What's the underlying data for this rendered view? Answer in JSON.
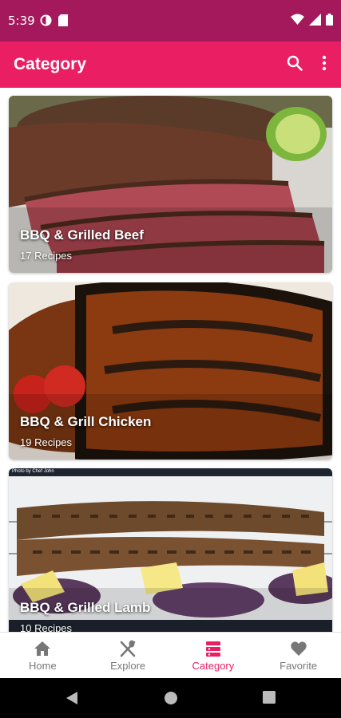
{
  "status_bar": {
    "time": "5:39"
  },
  "app_bar": {
    "title": "Category",
    "icons": [
      "search-icon",
      "more-vert-icon"
    ]
  },
  "categories": [
    {
      "title": "BBQ & Grilled Beef",
      "count": "17 Recipes"
    },
    {
      "title": "BBQ & Grill Chicken",
      "count": "19 Recipes"
    },
    {
      "title": "BBQ & Grilled Lamb",
      "count": "10 Recipes",
      "credit": "Photo by Chef John"
    }
  ],
  "bottom_nav": {
    "items": [
      {
        "label": "Home",
        "icon": "home-icon"
      },
      {
        "label": "Explore",
        "icon": "utensils-icon"
      },
      {
        "label": "Category",
        "icon": "category-icon",
        "active": true
      },
      {
        "label": "Favorite",
        "icon": "heart-icon"
      }
    ]
  },
  "colors": {
    "status_bar": "#a3195b",
    "primary": "#e91e63",
    "inactive": "#777777"
  }
}
